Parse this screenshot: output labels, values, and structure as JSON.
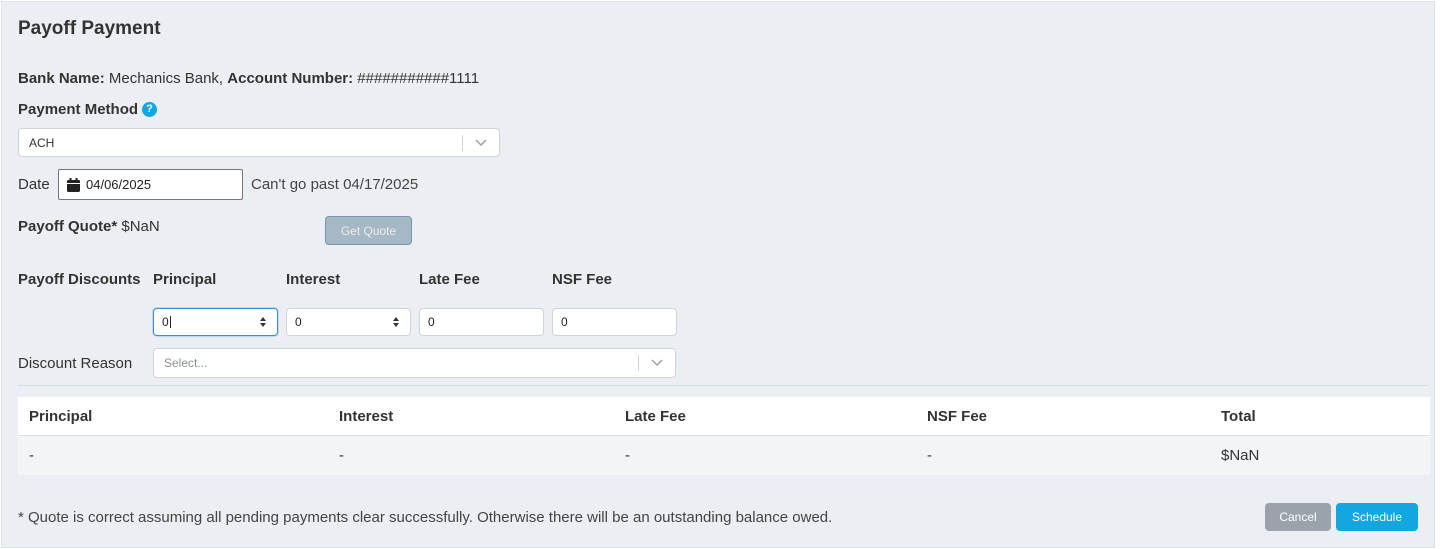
{
  "title": "Payoff Payment",
  "bank": {
    "bank_name_label": "Bank Name:",
    "bank_name_value": "Mechanics Bank,",
    "account_label": "Account Number:",
    "account_value": "###########1111"
  },
  "payment_method": {
    "label": "Payment Method",
    "help_icon": "question-circle-icon",
    "selected": "ACH"
  },
  "date": {
    "label": "Date",
    "value": "04/06/2025",
    "note": "Can't go past 04/17/2025"
  },
  "quote": {
    "label": "Payoff Quote*",
    "value": "$NaN",
    "button": "Get Quote"
  },
  "discounts": {
    "label": "Payoff Discounts",
    "columns": [
      "Principal",
      "Interest",
      "Late Fee",
      "NSF Fee"
    ],
    "values": [
      "0",
      "0",
      "0",
      "0"
    ],
    "reason_label": "Discount Reason",
    "reason_placeholder": "Select..."
  },
  "summary_table": {
    "headers": [
      "Principal",
      "Interest",
      "Late Fee",
      "NSF Fee",
      "Total"
    ],
    "row": [
      "-",
      "-",
      "-",
      "-",
      "$NaN"
    ]
  },
  "footer": {
    "note": "* Quote is correct assuming all pending payments clear successfully. Otherwise there will be an outstanding balance owed.",
    "cancel": "Cancel",
    "schedule": "Schedule"
  },
  "colors": {
    "accent": "#12a7e0",
    "panel_bg": "#ebeef2",
    "disabled_button": "#a6b7c5",
    "cancel_button": "#9aa3ab"
  }
}
